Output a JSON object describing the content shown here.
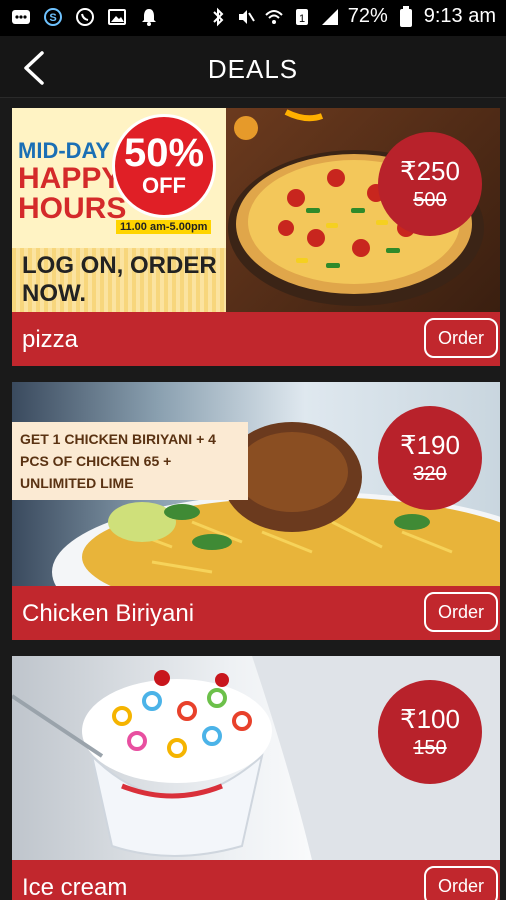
{
  "status_bar": {
    "battery": "72%",
    "time": "9:13 am"
  },
  "app_bar": {
    "title": "DEALS"
  },
  "deals": [
    {
      "name": "pizza",
      "price": "₹250",
      "old_price": "500",
      "order_label": "Order",
      "banner": {
        "line1": "MID-DAY",
        "line2": "HAPPY HOURS",
        "discount": "50%",
        "off": "OFF",
        "hours": "11.00 am-5.00pm",
        "cta": "LOG ON, ORDER NOW."
      }
    },
    {
      "name": "Chicken Biriyani",
      "price": "₹190",
      "old_price": "320",
      "order_label": "Order",
      "banner": {
        "caption": "GET 1 CHICKEN BIRIYANI + 4 PCS OF CHICKEN 65 + UNLIMITED LIME"
      }
    },
    {
      "name": "Ice cream",
      "price": "₹100",
      "old_price": "150",
      "order_label": "Order"
    }
  ],
  "colors": {
    "accent_red": "#c1272d",
    "badge_red": "#b8222b",
    "appbar_bg": "#161616"
  }
}
